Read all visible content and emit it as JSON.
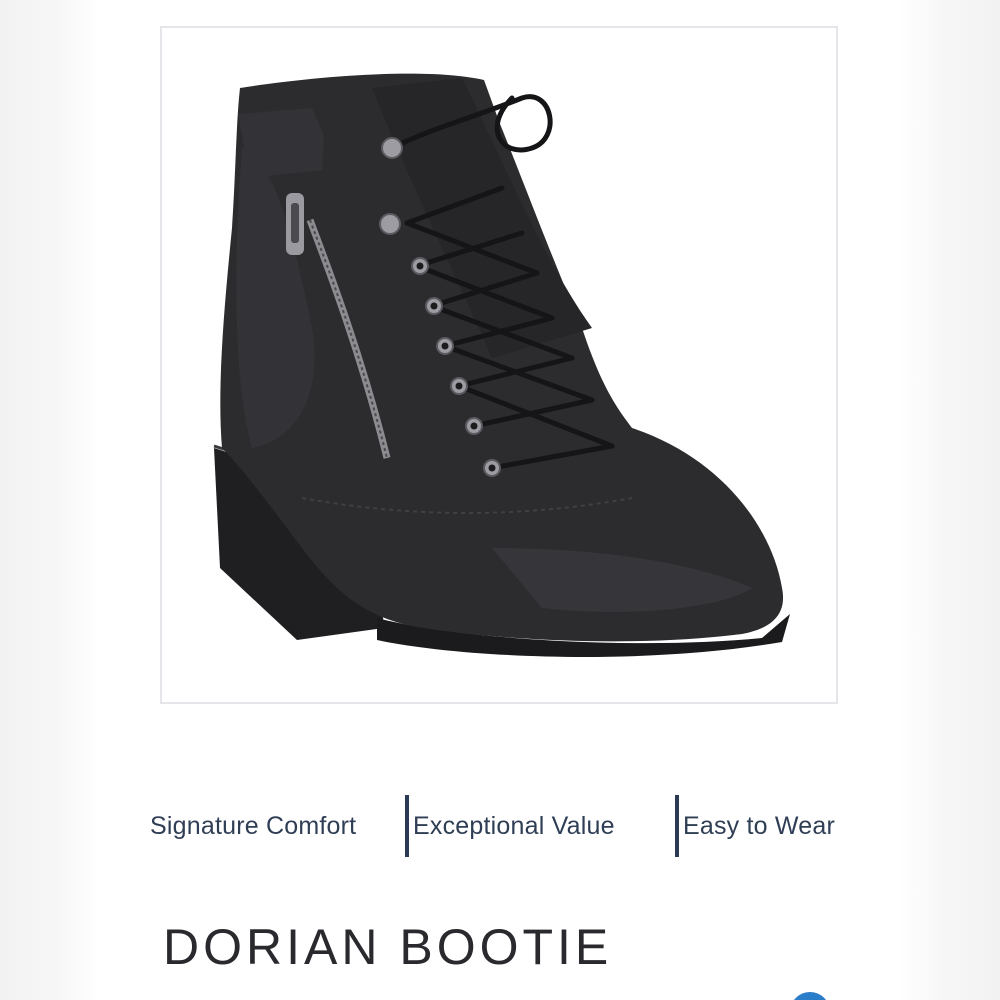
{
  "product": {
    "image_alt": "Black lace-up heeled ankle bootie with side zipper",
    "features": [
      {
        "label": "Signature Comfort"
      },
      {
        "label": "Exceptional Value"
      },
      {
        "label": "Easy to Wear"
      }
    ],
    "title": "DORIAN BOOTIE"
  },
  "colors": {
    "feature_text": "#2f3e55",
    "divider": "#2b3a54",
    "title_text": "#2a2a2e",
    "boot": "#2c2c2f",
    "badge": "#2a7dc9"
  },
  "icons": {
    "badge": "circle-badge-icon"
  }
}
